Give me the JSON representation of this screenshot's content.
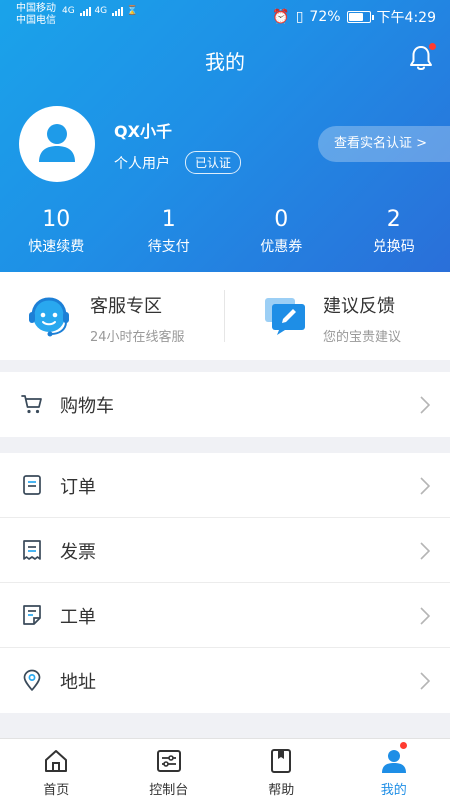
{
  "status_bar": {
    "carrier_1": "中国移动",
    "carrier_2": "中国电信",
    "network_1": "4G",
    "network_2": "4G",
    "battery_percent": "72%",
    "battery_level": 0.72,
    "time": "下午4:29"
  },
  "header": {
    "title": "我的",
    "notification_dot": true
  },
  "profile": {
    "name": "QX小千",
    "user_type": "个人用户",
    "verified_badge": "已认证",
    "realname_button": "查看实名认证 >"
  },
  "stats": [
    {
      "value": "10",
      "label": "快速续费"
    },
    {
      "value": "1",
      "label": "待支付"
    },
    {
      "value": "0",
      "label": "优惠券"
    },
    {
      "value": "2",
      "label": "兑换码"
    }
  ],
  "services": {
    "customer_service": {
      "title": "客服专区",
      "subtitle": "24小时在线客服"
    },
    "feedback": {
      "title": "建议反馈",
      "subtitle": "您的宝贵建议"
    }
  },
  "menu": {
    "cart": "购物车",
    "orders": "订单",
    "invoice": "发票",
    "ticket": "工单",
    "address": "地址"
  },
  "tabbar": {
    "home": "首页",
    "console": "控制台",
    "help": "帮助",
    "mine": "我的"
  },
  "colors": {
    "accent": "#1e8ee6",
    "header_gradient_start": "#1aa3ea",
    "header_gradient_end": "#2a6fd9",
    "badge_red": "#ff3b30"
  }
}
